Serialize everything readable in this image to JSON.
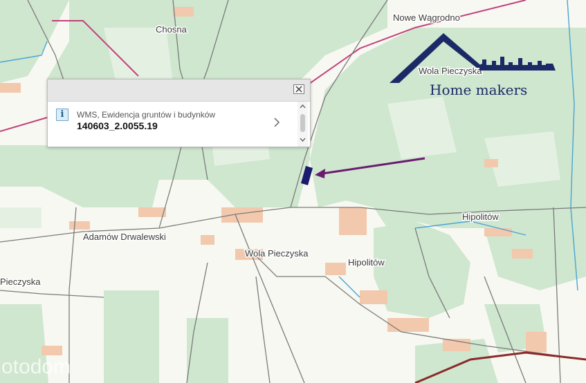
{
  "map": {
    "place_labels": [
      {
        "id": "chosna",
        "text": "Chosna"
      },
      {
        "id": "nowe-wagrodno",
        "text": "Nowe Wągrodno"
      },
      {
        "id": "wola-pieczyska-top",
        "text": "Wola Pieczyska"
      },
      {
        "id": "adamow-drwalewski",
        "text": "Adamów Drwalewski"
      },
      {
        "id": "wola-pieczyska",
        "text": "Wola Pieczyska"
      },
      {
        "id": "hipolitow-center",
        "text": "Hipolitów"
      },
      {
        "id": "hipolitow-east",
        "text": "Hipolitów"
      },
      {
        "id": "pieczyska-west",
        "text": "Pieczyska"
      }
    ],
    "colors": {
      "forest": "#cfe6cf",
      "field": "#f8f8f2",
      "builtup": "#f2c9ad",
      "road": "#7a7a7a",
      "boundary": "#c0407a",
      "water": "#4aa3d4",
      "parcel": "#1a1a6e",
      "arrow": "#6a1b6e"
    }
  },
  "popup": {
    "layer_name": "WMS, Ewidencja gruntów i budynków",
    "parcel_id": "140603_2.0055.19",
    "info_icon_glyph": "i",
    "icons": [
      "info-icon",
      "close-icon",
      "chevron-right-icon",
      "scroll-up-icon",
      "scroll-down-icon"
    ]
  },
  "logo": {
    "text": "Home makers",
    "color": "#1b2a66"
  },
  "watermark": {
    "text": "otodom"
  }
}
